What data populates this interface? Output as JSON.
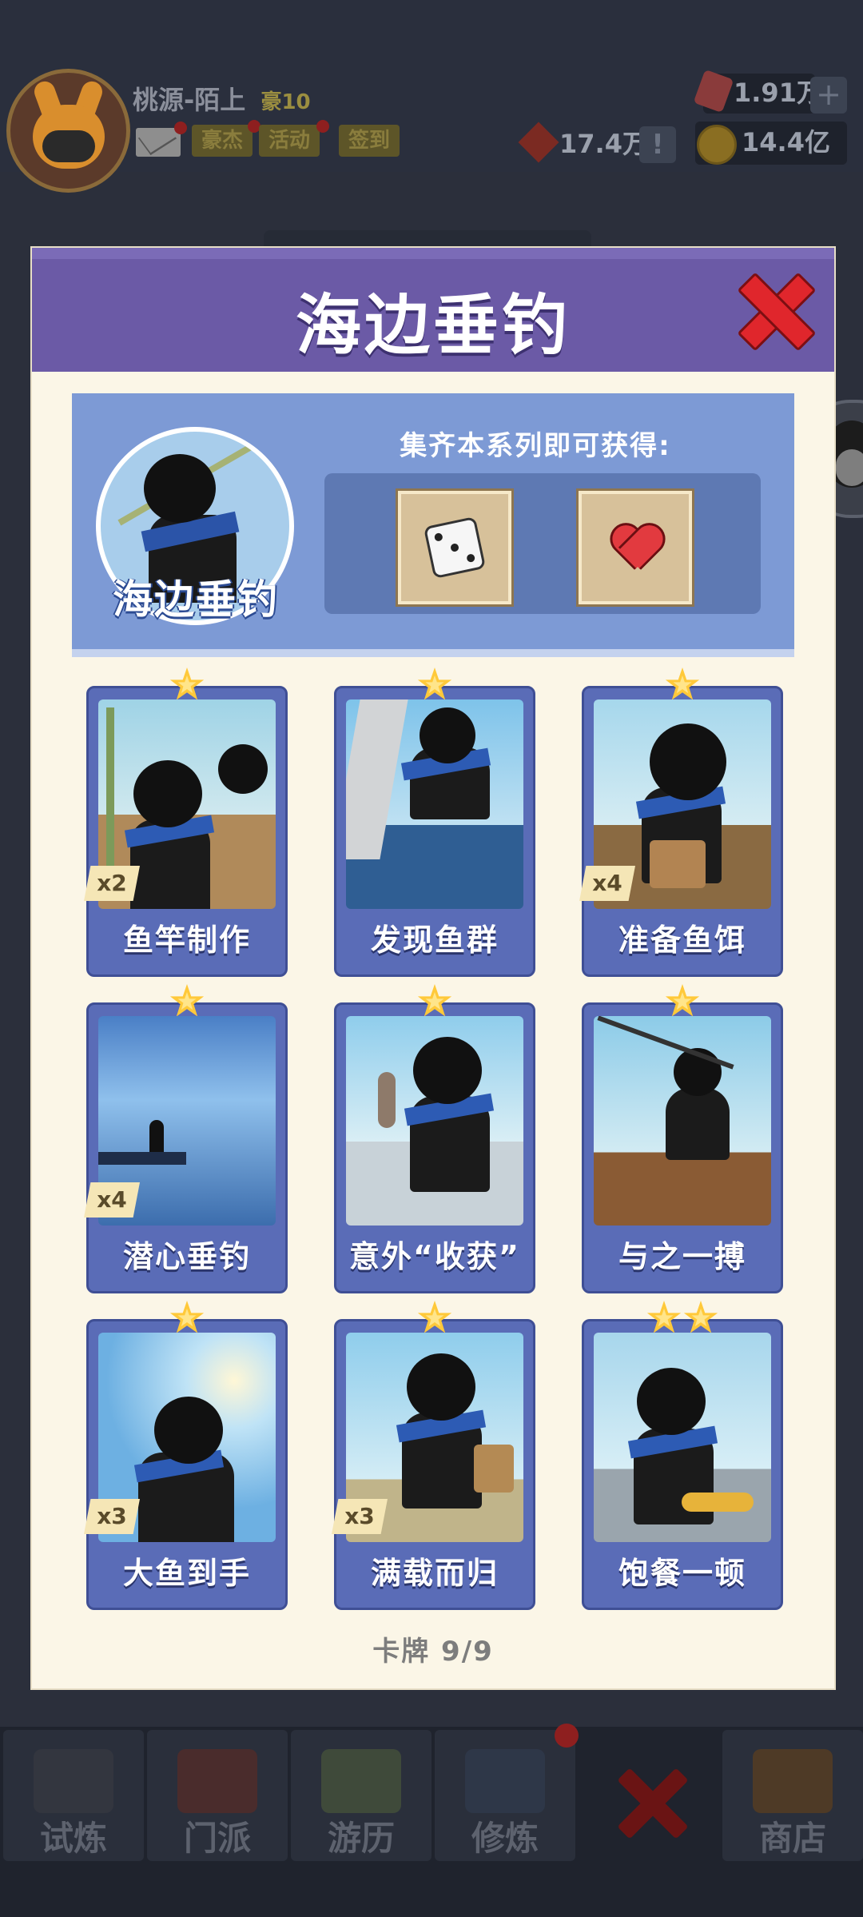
{
  "player": {
    "name": "桃源-陌上",
    "vip": "豪10",
    "buttons": [
      "豪杰",
      "活动",
      "签到"
    ]
  },
  "resources": {
    "gems": "1.91万",
    "tokens": "17.4万",
    "coins": "14.4亿"
  },
  "modal": {
    "title": "海边垂钓",
    "series_label": "海边垂钓",
    "reward_caption": "集齐本系列即可获得:",
    "rewards": [
      "dice-icon",
      "heart-icon"
    ],
    "footer": "卡牌  9/9",
    "cards": [
      {
        "name": "鱼竿制作",
        "stars": 1,
        "count": "x2"
      },
      {
        "name": "发现鱼群",
        "stars": 1,
        "count": ""
      },
      {
        "name": "准备鱼饵",
        "stars": 1,
        "count": "x4"
      },
      {
        "name": "潜心垂钓",
        "stars": 1,
        "count": "x4"
      },
      {
        "name": "意外“收获”",
        "stars": 1,
        "count": ""
      },
      {
        "name": "与之一搏",
        "stars": 1,
        "count": ""
      },
      {
        "name": "大鱼到手",
        "stars": 1,
        "count": "x3"
      },
      {
        "name": "满载而归",
        "stars": 1,
        "count": "x3"
      },
      {
        "name": "饱餐一顿",
        "stars": 2,
        "count": ""
      }
    ]
  },
  "bottom_nav": [
    "试炼",
    "门派",
    "游历",
    "修炼",
    "",
    "商店"
  ],
  "colors": {
    "header": "#6b5aa6",
    "card": "#5a6cb7",
    "star": "#ffc93a",
    "close": "#e0262c"
  }
}
